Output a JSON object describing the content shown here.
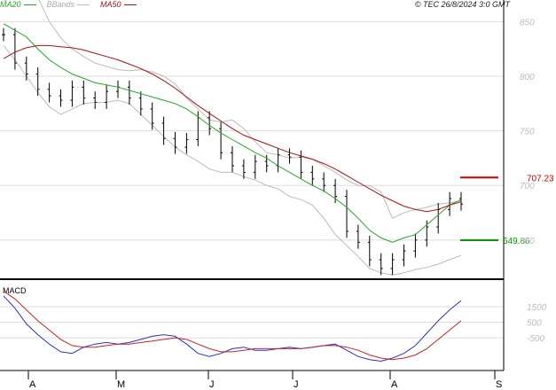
{
  "header": {
    "credit": "© TEC 26/8/2024 3:0 GMT",
    "legend": [
      {
        "label": "MA20",
        "color": "#22aa22"
      },
      {
        "label": "BBands",
        "color": "#bbbbbb"
      },
      {
        "label": "MA50",
        "color": "#aa1111"
      }
    ]
  },
  "chart_data": [
    {
      "type": "line",
      "subtype": "price-bars-with-overlays",
      "x_ticks": [
        "A",
        "M",
        "J",
        "J",
        "A",
        "S"
      ],
      "y_ticks": [
        "850",
        "800",
        "750",
        "700",
        "650"
      ],
      "ylim": [
        615,
        860
      ],
      "grid": true,
      "markers": [
        {
          "name": "MA50",
          "label": "707.23",
          "value": 707.23,
          "color": "#cc0000"
        },
        {
          "name": "MA20",
          "label": "649.86",
          "value": 649.86,
          "color": "#009900"
        }
      ],
      "series": [
        {
          "name": "MA20",
          "color": "#22aa22",
          "values": [
            848,
            842,
            836,
            825,
            815,
            808,
            802,
            798,
            794,
            792,
            790,
            787,
            784,
            781,
            778,
            775,
            770,
            763,
            755,
            748,
            742,
            736,
            730,
            725,
            718,
            712,
            706,
            700,
            695,
            688,
            680,
            670,
            659,
            652,
            648,
            652,
            655,
            664,
            673,
            682,
            687
          ]
        },
        {
          "name": "MA50",
          "color": "#aa1111",
          "values": [
            816,
            822,
            826,
            828,
            828,
            827,
            826,
            824,
            821,
            818,
            815,
            811,
            807,
            802,
            796,
            789,
            781,
            773,
            766,
            759,
            752,
            746,
            742,
            738,
            734,
            730,
            727,
            724,
            720,
            715,
            709,
            703,
            697,
            691,
            686,
            681,
            678,
            676,
            678,
            682,
            685
          ]
        },
        {
          "name": "BBands upper",
          "color": "#bbbbbb",
          "values": [
            868,
            875,
            880,
            872,
            850,
            835,
            825,
            818,
            812,
            809,
            806,
            805,
            806,
            804,
            800,
            793,
            780,
            770,
            760,
            758,
            760,
            752,
            740,
            730,
            728,
            725,
            726,
            724,
            718,
            712,
            705,
            700,
            700,
            694,
            670,
            675,
            678,
            680,
            683,
            684,
            686
          ]
        },
        {
          "name": "BBands lower",
          "color": "#bbbbbb",
          "values": [
            828,
            815,
            800,
            785,
            772,
            765,
            770,
            775,
            776,
            776,
            778,
            775,
            765,
            755,
            745,
            735,
            728,
            722,
            715,
            712,
            712,
            708,
            705,
            700,
            697,
            690,
            687,
            682,
            670,
            655,
            645,
            635,
            624,
            620,
            618,
            620,
            623,
            625,
            628,
            632,
            636
          ]
        },
        {
          "name": "Price",
          "color": "#000000",
          "values": [
            838,
            812,
            802,
            788,
            782,
            778,
            790,
            780,
            776,
            786,
            790,
            780,
            770,
            757,
            743,
            735,
            742,
            762,
            752,
            730,
            718,
            712,
            722,
            718,
            728,
            726,
            712,
            706,
            700,
            690,
            658,
            648,
            632,
            624,
            632,
            640,
            650,
            662,
            678,
            688,
            683
          ]
        }
      ]
    },
    {
      "type": "line",
      "title": "MACD",
      "y_ticks": [
        "1500",
        "500",
        "-500"
      ],
      "ylim": [
        -2600,
        3100
      ],
      "grid": true,
      "x_ticks": [
        "A",
        "M",
        "J",
        "J",
        "A",
        "S"
      ],
      "series": [
        {
          "name": "MACD",
          "color": "#2233cc",
          "values": [
            2200,
            1400,
            400,
            -300,
            -900,
            -1400,
            -1500,
            -1100,
            -900,
            -800,
            -900,
            -800,
            -600,
            -400,
            -300,
            -400,
            -900,
            -1500,
            -1700,
            -1500,
            -1200,
            -1100,
            -1300,
            -1300,
            -1200,
            -1100,
            -1200,
            -1100,
            -1000,
            -900,
            -1300,
            -1700,
            -1900,
            -2000,
            -1800,
            -1500,
            -1000,
            -200,
            600,
            1300,
            1900
          ]
        },
        {
          "name": "Signal",
          "color": "#cc2222",
          "values": [
            2500,
            2000,
            1300,
            600,
            0,
            -600,
            -1000,
            -1100,
            -1100,
            -1000,
            -900,
            -900,
            -800,
            -700,
            -600,
            -500,
            -600,
            -900,
            -1200,
            -1400,
            -1400,
            -1300,
            -1200,
            -1200,
            -1200,
            -1200,
            -1200,
            -1100,
            -1000,
            -1000,
            -1100,
            -1300,
            -1600,
            -1800,
            -1900,
            -1800,
            -1600,
            -1200,
            -600,
            0,
            600
          ]
        }
      ]
    }
  ]
}
